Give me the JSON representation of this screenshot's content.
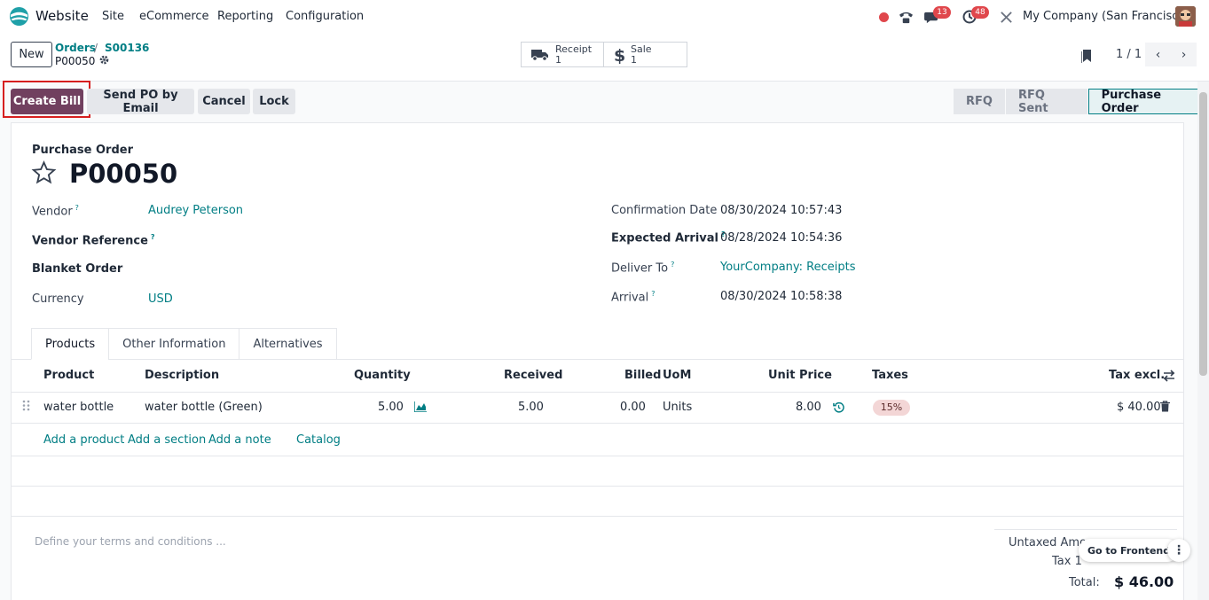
{
  "navbar": {
    "app_name": "Website",
    "menu": [
      "Site",
      "eCommerce",
      "Reporting",
      "Configuration"
    ],
    "chat_count": "13",
    "activity_count": "48",
    "company": "My Company (San Francisco)"
  },
  "control": {
    "new_label": "New",
    "breadcrumb": [
      "Orders",
      "S00136"
    ],
    "current": "P00050",
    "smart_buttons": [
      {
        "label": "Receipt",
        "value": "1",
        "icon": "truck-icon"
      },
      {
        "label": "Sale",
        "value": "1",
        "icon": "dollar-icon"
      }
    ],
    "pager": "1 / 1"
  },
  "actions": {
    "create_bill": "Create Bill",
    "send_po": "Send PO by Email",
    "cancel": "Cancel",
    "lock": "Lock"
  },
  "stages": [
    "RFQ",
    "RFQ Sent",
    "Purchase Order"
  ],
  "form": {
    "title_label": "Purchase Order",
    "name": "P00050",
    "vendor_label": "Vendor",
    "vendor": "Audrey Peterson",
    "vendor_ref_label": "Vendor Reference",
    "blanket_label": "Blanket Order",
    "currency_label": "Currency",
    "currency": "USD",
    "confirmation_label": "Confirmation Date",
    "confirmation": "08/30/2024 10:57:43",
    "expected_label": "Expected Arrival",
    "expected": "08/28/2024 10:54:36",
    "deliver_label": "Deliver To",
    "deliver": "YourCompany: Receipts",
    "arrival_label": "Arrival",
    "arrival": "08/30/2024 10:58:38",
    "help_mark": "?"
  },
  "tabs": [
    "Products",
    "Other Information",
    "Alternatives"
  ],
  "table": {
    "headers": [
      "Product",
      "Description",
      "Quantity",
      "Received",
      "Billed",
      "UoM",
      "Unit Price",
      "Taxes",
      "Tax excl."
    ],
    "rows": [
      {
        "product": "water bottle",
        "description": "water bottle (Green)",
        "quantity": "5.00",
        "received": "5.00",
        "billed": "0.00",
        "uom": "Units",
        "unit_price": "8.00",
        "taxes": "15%",
        "tax_excl": "$ 40.00"
      }
    ],
    "add_links": [
      "Add a product",
      "Add a section",
      "Add a note",
      "Catalog"
    ]
  },
  "footer": {
    "terms_placeholder": "Define your terms and conditions ...",
    "untaxed_label": "Untaxed Amo",
    "tax_label": "Tax 1",
    "total_label": "Total:",
    "total": "$ 46.00",
    "go_frontend": "Go to Frontend"
  },
  "colors": {
    "primary": "#71405f",
    "link": "#017e84",
    "highlight": "#d61f1f"
  }
}
